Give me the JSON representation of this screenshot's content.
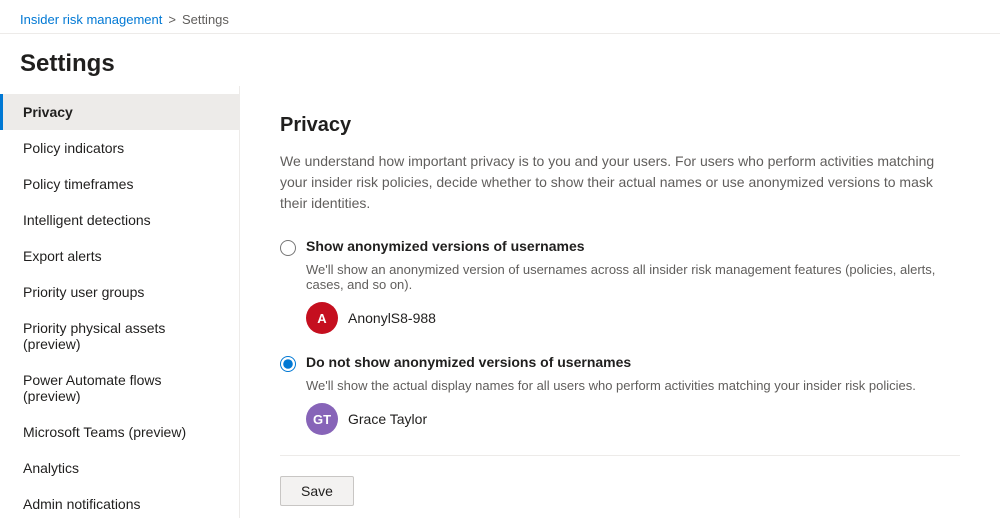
{
  "breadcrumb": {
    "parent": "Insider risk management",
    "separator": ">",
    "current": "Settings"
  },
  "page": {
    "title": "Settings"
  },
  "sidebar": {
    "items": [
      {
        "id": "privacy",
        "label": "Privacy",
        "active": true
      },
      {
        "id": "policy-indicators",
        "label": "Policy indicators",
        "active": false
      },
      {
        "id": "policy-timeframes",
        "label": "Policy timeframes",
        "active": false
      },
      {
        "id": "intelligent-detections",
        "label": "Intelligent detections",
        "active": false
      },
      {
        "id": "export-alerts",
        "label": "Export alerts",
        "active": false
      },
      {
        "id": "priority-user-groups",
        "label": "Priority user groups",
        "active": false
      },
      {
        "id": "priority-physical-assets",
        "label": "Priority physical assets (preview)",
        "active": false
      },
      {
        "id": "power-automate-flows",
        "label": "Power Automate flows (preview)",
        "active": false
      },
      {
        "id": "microsoft-teams",
        "label": "Microsoft Teams (preview)",
        "active": false
      },
      {
        "id": "analytics",
        "label": "Analytics",
        "active": false
      },
      {
        "id": "admin-notifications",
        "label": "Admin notifications",
        "active": false
      }
    ]
  },
  "content": {
    "title": "Privacy",
    "description": "We understand how important privacy is to you and your users. For users who perform activities matching your insider risk policies, decide whether to show their actual names or use anonymized versions to mask their identities.",
    "option1": {
      "label": "Show anonymized versions of usernames",
      "description": "We'll show an anonymized version of usernames across all insider risk management features (policies, alerts, cases, and so on).",
      "user": {
        "initials": "A",
        "name": "AnonylS8-988",
        "avatar_color": "#c50f1f"
      },
      "selected": false
    },
    "option2": {
      "label": "Do not show anonymized versions of usernames",
      "description": "We'll show the actual display names for all users who perform activities matching your insider risk policies.",
      "user": {
        "initials": "GT",
        "name": "Grace Taylor",
        "avatar_color": "#8764b8"
      },
      "selected": true
    },
    "save_button": "Save"
  }
}
